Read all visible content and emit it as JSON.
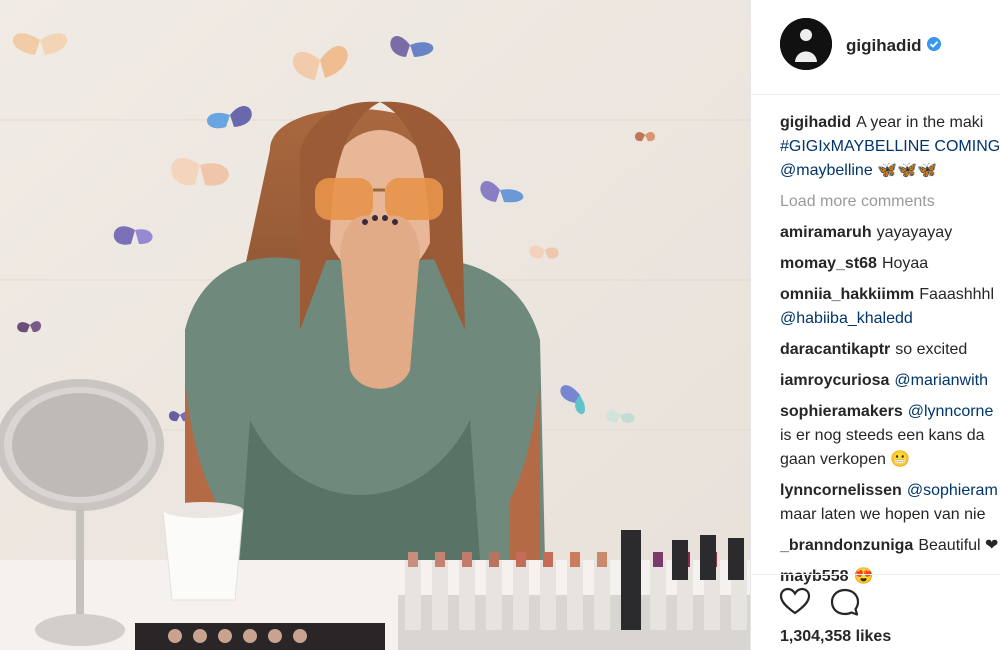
{
  "post": {
    "username": "gigihadid",
    "verified": true,
    "caption": {
      "user": "gigihadid",
      "line1": "A year in the maki",
      "line2": "#GIGIxMAYBELLINE COMING",
      "line3_tag": "@maybelline",
      "line3_emoji": "🦋🦋🦋"
    },
    "load_more": "Load more comments",
    "comments": [
      {
        "user": "amiramaruh",
        "text": "yayayayay"
      },
      {
        "user": "momay_st68",
        "text": "Hoyaa"
      },
      {
        "user": "omniia_hakkiimm",
        "text": "Faaashhhl",
        "line2_tag": "@habiiba_khaledd"
      },
      {
        "user": "daracantikaptr",
        "text": "so excited"
      },
      {
        "user": "iamroycuriosa",
        "tag": "@marianwith"
      },
      {
        "user": "sophieramakers",
        "tag": "@lynncorne",
        "line2": "is er nog steeds een kans da",
        "line3": "gaan verkopen 😬"
      },
      {
        "user": "lynncornelissen",
        "tag": "@sophieram",
        "line2": "maar laten we hopen van nie"
      },
      {
        "user": "_branndonzuniga",
        "text": "Beautiful ❤"
      },
      {
        "user": "mayb558",
        "text": "😍"
      }
    ],
    "likes": "1,304,358 likes"
  },
  "icons": {
    "like": "heart-icon",
    "comment": "comment-icon"
  },
  "colors": {
    "link": "#003569",
    "verified": "#3897f0",
    "muted": "#999999",
    "text": "#262626"
  }
}
